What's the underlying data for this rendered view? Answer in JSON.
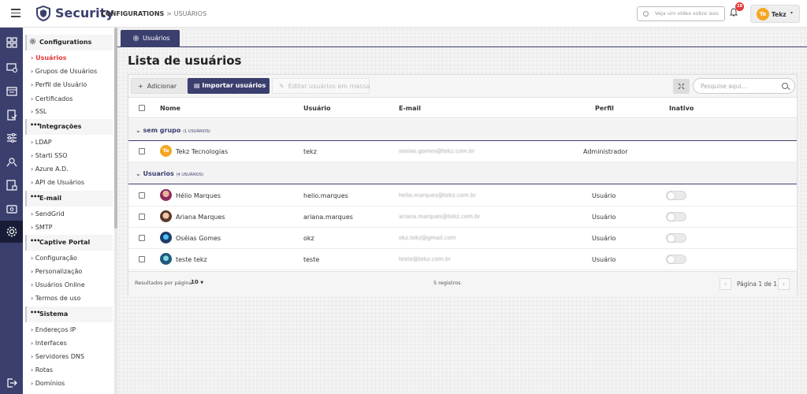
{
  "header": {
    "logo_text": "Security",
    "breadcrumb_main": "CONFIGURATIONS",
    "breadcrumb_sep": ">",
    "breadcrumb_current": "USUÁRIOS",
    "video_placeholder": "Veja um vídeo sobre isso",
    "notifications_count": "28",
    "user_initials": "Te",
    "user_name": "Tekz",
    "user_chevron": "▾"
  },
  "rail": {
    "icons": [
      "dashboard-icon",
      "monitor-settings-icon",
      "window-list-icon",
      "clipboard-check-icon",
      "sliders-icon",
      "network-settings-icon",
      "lock-id-icon",
      "card-icon",
      "gear-icon"
    ],
    "active_index": 8,
    "logout_icon": "logout-icon"
  },
  "subnav": {
    "sections": [
      {
        "title": "Configurations",
        "icon": "gear-icon",
        "items": [
          "Usuários",
          "Grupos de Usuários",
          "Perfil de Usuário",
          "Certificados",
          "SSL"
        ]
      },
      {
        "title": "Integrações",
        "icon": "dots-icon",
        "items": [
          "LDAP",
          "Starti SSO",
          "Azure A.D.",
          "API de Usuários"
        ]
      },
      {
        "title": "E-mail",
        "icon": "dots-icon",
        "items": [
          "SendGrid",
          "SMTP"
        ]
      },
      {
        "title": "Captive Portal",
        "icon": "dots-icon",
        "items": [
          "Configuração",
          "Personalização",
          "Usuários Online",
          "Termos de uso"
        ]
      },
      {
        "title": "Sistema",
        "icon": "dots-icon",
        "items": [
          "Endereços IP",
          "Interfaces",
          "Servidores DNS",
          "Rotas",
          "Domínios"
        ]
      }
    ],
    "active_item": "Usuários"
  },
  "tab": {
    "label": "Usuários"
  },
  "page": {
    "title": "Lista de usuários"
  },
  "toolbar": {
    "add_label": "Adicionar",
    "import_label": "Importar usuários",
    "edit_label": "Editar usuários em massa",
    "search_placeholder": "Pesquise aqui..."
  },
  "table": {
    "columns": [
      "Nome",
      "Usuário",
      "E-mail",
      "Perfil",
      "Inativo"
    ],
    "groups": [
      {
        "name": "sem grupo",
        "count": "(1 USUÁRIOS)",
        "rows": [
          {
            "name": "Tekz Tecnologias",
            "user": "tekz",
            "email": "oseias.gomes@tekz.com.br",
            "profile": "Administrador",
            "avatar": "initials",
            "initials": "Te",
            "avatar_color": "#f5a623",
            "toggle": false
          }
        ]
      },
      {
        "name": "Usuarios",
        "count": "(4 USUÁRIOS)",
        "rows": [
          {
            "name": "Hélio Marques",
            "user": "helio.marques",
            "email": "helio.marques@tekz.com.br",
            "profile": "Usuário",
            "avatar": "photo",
            "avatar_color": "#8b2b5c",
            "toggle": true
          },
          {
            "name": "Ariana Marques",
            "user": "ariana.marques",
            "email": "ariana.marques@tekz.com.br",
            "profile": "Usuário",
            "avatar": "photo",
            "avatar_color": "#c98a6a",
            "toggle": true
          },
          {
            "name": "Oséias Gomes",
            "user": "okz",
            "email": "okz.tekz@gmail.com",
            "profile": "Usuário",
            "avatar": "photo",
            "avatar_color": "#1b4f7a",
            "toggle": true
          },
          {
            "name": "teste tekz",
            "user": "teste",
            "email": "teste@tekz.com.br",
            "profile": "Usuário",
            "avatar": "photo",
            "avatar_color": "#1f7a8c",
            "toggle": true
          }
        ]
      }
    ]
  },
  "footer": {
    "per_page_label": "Resultados por página",
    "per_page_value": "10",
    "records": "5 registros",
    "page_label": "Página 1 de 1",
    "prev": "‹",
    "next": "›"
  }
}
